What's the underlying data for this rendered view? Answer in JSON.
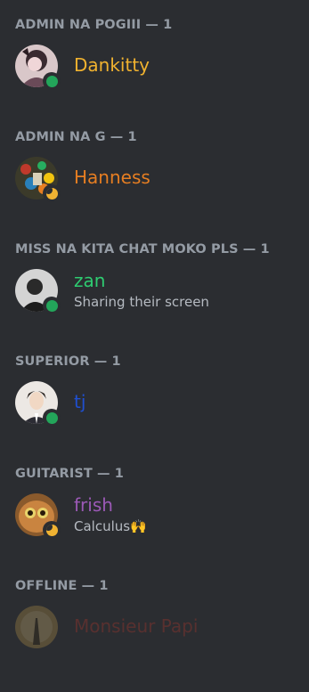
{
  "groups": [
    {
      "header": "ADMIN NA POGIII — 1",
      "member": {
        "name": "Dankitty",
        "name_color": "#f0b22f",
        "status": "online",
        "subtext": ""
      }
    },
    {
      "header": "ADMIN NA G — 1",
      "member": {
        "name": "Hanness",
        "name_color": "#e67e22",
        "status": "idle",
        "subtext": ""
      }
    },
    {
      "header": "MISS NA KITA CHAT MOKO PLS — 1",
      "member": {
        "name": "zan",
        "name_color": "#2ecc71",
        "status": "online",
        "subtext": "Sharing their screen"
      }
    },
    {
      "header": "SUPERIOR — 1",
      "member": {
        "name": "tj",
        "name_color": "#1f4fd1",
        "status": "online",
        "subtext": ""
      }
    },
    {
      "header": "GUITARIST — 1",
      "member": {
        "name": "frish",
        "name_color": "#9b59b6",
        "status": "idle",
        "subtext": "Calculus🙌"
      }
    },
    {
      "header": "OFFLINE — 1",
      "member": {
        "name": "Monsieur Papi",
        "name_color": "#c0392b",
        "status": "offline",
        "subtext": ""
      }
    }
  ],
  "colors": {
    "background": "#2b2d31",
    "header_text": "#949ba4",
    "online": "#23a55a",
    "idle": "#f0b232"
  }
}
